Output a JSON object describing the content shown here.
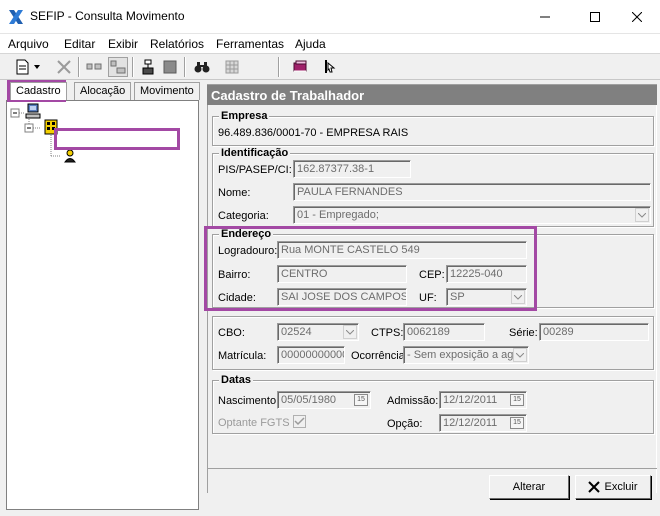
{
  "window": {
    "title": "SEFIP - Consulta Movimento",
    "icon": "sefip-x-icon"
  },
  "menu": [
    "Arquivo",
    "Editar",
    "Exibir",
    "Relatórios",
    "Ferramentas",
    "Ajuda"
  ],
  "tabs": [
    "Cadastro",
    "Alocação",
    "Movimento"
  ],
  "panel": {
    "title": "Cadastro de Trabalhador"
  },
  "empresa": {
    "group_title": "Empresa",
    "value": "96.489.836/0001-70 -  EMPRESA RAIS"
  },
  "identificacao": {
    "group_title": "Identificação",
    "pis_label": "PIS/PASEP/CI:",
    "pis_value": "162.87377.38-1",
    "nome_label": "Nome:",
    "nome_value": "PAULA FERNANDES",
    "categoria_label": "Categoria:",
    "categoria_value": "01 - Empregado;"
  },
  "endereco": {
    "group_title": "Endereço",
    "logradouro_label": "Logradouro:",
    "logradouro_value": "Rua MONTE CASTELO 549",
    "bairro_label": "Bairro:",
    "bairro_value": "CENTRO",
    "cep_label": "CEP:",
    "cep_value": "12225-040",
    "cidade_label": "Cidade:",
    "cidade_value": "SAI JOSE DOS CAMPOS",
    "uf_label": "UF:",
    "uf_value": "SP"
  },
  "outros": {
    "cbo_label": "CBO:",
    "cbo_value": "02524",
    "ctps_label": "CTPS:",
    "ctps_value": "0062189",
    "serie_label": "Série:",
    "serie_value": "00289",
    "matricula_label": "Matrícula:",
    "matricula_value": "00000000000",
    "ocorrencia_label": "Ocorrência:",
    "ocorrencia_value": "- Sem exposição a age"
  },
  "datas": {
    "group_title": "Datas",
    "nascimento_label": "Nascimento:",
    "nascimento_value": "05/05/1980",
    "admissao_label": "Admissão:",
    "admissao_value": "12/12/2011",
    "optante_label": "Optante FGTS",
    "opcao_label": "Opção:",
    "opcao_value": "12/12/2011",
    "calendar_glyph": "15"
  },
  "buttons": {
    "alterar": "Alterar",
    "excluir": "Excluir"
  },
  "colors": {
    "highlight": "#a349a4",
    "header_bg": "#808080"
  }
}
